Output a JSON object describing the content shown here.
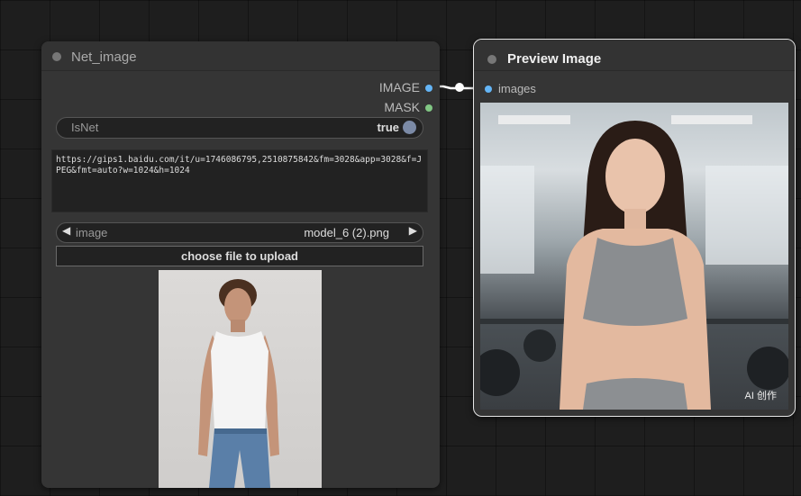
{
  "left_node": {
    "title": "Net_image",
    "outputs": [
      {
        "label": "IMAGE",
        "color": "#64b5f6"
      },
      {
        "label": "MASK",
        "color": "#81c784"
      }
    ],
    "toggle": {
      "label": "IsNet",
      "value": "true"
    },
    "url": "https://gips1.baidu.com/it/u=1746086795,2510875842&fm=3028&app=3028&f=JPEG&fmt=auto?w=1024&h=1024",
    "image_combo": {
      "label": "image",
      "value": "model_6 (2).png"
    },
    "upload_label": "choose file to upload"
  },
  "right_node": {
    "title": "Preview Image",
    "input_label": "images",
    "input_color": "#64b5f6",
    "watermark": "AI 创作"
  },
  "colors": {
    "canvas_bg": "#1e1e1e",
    "node_bg": "#353535",
    "wire": "#ffffff"
  }
}
